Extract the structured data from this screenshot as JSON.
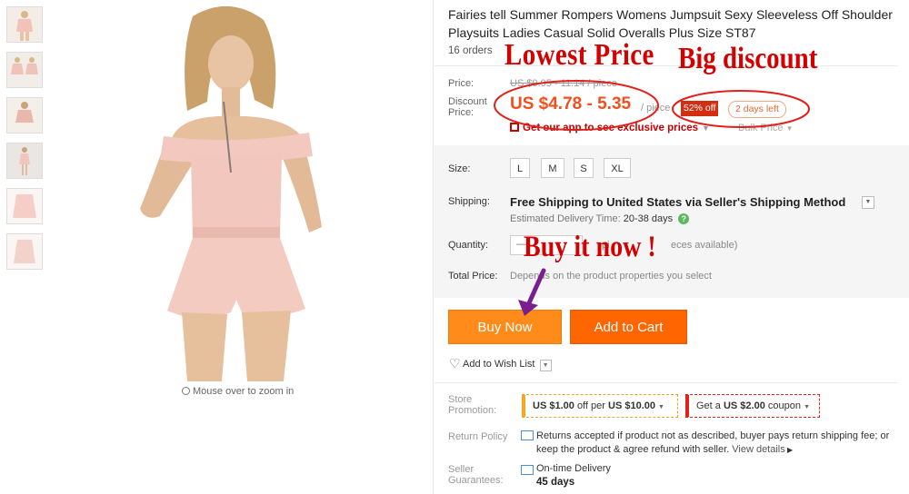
{
  "gallery": {
    "zoom_hint": "Mouse over to zoom in"
  },
  "product": {
    "title": "Fairies tell Summer Rompers Womens Jumpsuit Sexy Sleeveless Off Shoulder Playsuits Ladies Casual Solid Overalls Plus Size ST87",
    "orders": "16 orders"
  },
  "price": {
    "label": "Price:",
    "original": "US $9.95 - 11.14 / piece",
    "discount_label": "Discount Price:",
    "discount": "US $4.78 - 5.35",
    "per_piece": "/ piece",
    "off_badge": "52% off",
    "days_left": "2 days left",
    "app_promo": "Get our app to see exclusive prices",
    "bulk_price": "Bulk Price"
  },
  "options": {
    "size_label": "Size:",
    "sizes": [
      "L",
      "M",
      "S",
      "XL"
    ],
    "shipping_label": "Shipping:",
    "shipping": "Free Shipping to United States via Seller's Shipping Method",
    "delivery_label": "Estimated Delivery Time:",
    "delivery": "20-38 days",
    "quantity_label": "Quantity:",
    "quantity_minus": "—",
    "quantity_note_a": "pi",
    "quantity_note_b": "eces available)",
    "total_label": "Total Price:",
    "total_text": "Depends on the product properties you select"
  },
  "actions": {
    "buy_now": "Buy Now",
    "add_to_cart": "Add to Cart",
    "wish_list": "Add to Wish List"
  },
  "promotion": {
    "store_label": "Store Promotion:",
    "coupon1_amount": "US $1.00",
    "coupon1_mid": "off per",
    "coupon1_min": "US $10.00",
    "coupon2_pre": "Get a",
    "coupon2_amount": "US $2.00",
    "coupon2_post": "coupon",
    "return_label": "Return Policy",
    "return_text": "Returns accepted if product not as described, buyer pays return shipping fee; or keep the product & agree refund with seller.",
    "view_details": "View details",
    "seller_label": "Seller Guarantees:",
    "ontime": "On-time Delivery",
    "ontime_days": "45 days"
  },
  "annotations": {
    "lowest_price": "Lowest Price",
    "big_discount": "Big discount",
    "buy_it_now": "Buy it now !"
  },
  "colors": {
    "accent_orange": "#ff8c1a",
    "cart_orange": "#ff6600",
    "price_red": "#f44e1c",
    "annotation_red": "#d40000",
    "arrow_purple": "#7a1f8f"
  }
}
